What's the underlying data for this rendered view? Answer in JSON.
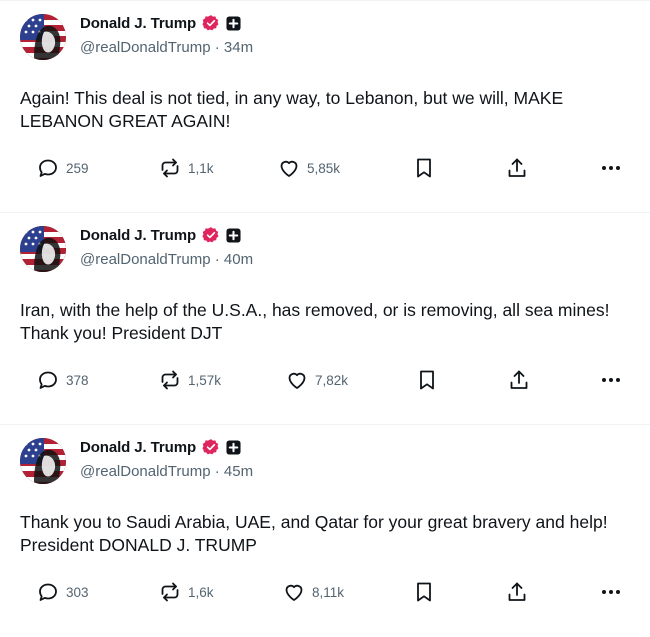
{
  "posts": [
    {
      "author": "Donald J. Trump",
      "handle": "@realDonaldTrump",
      "separator": "·",
      "time": "34m",
      "text": "Again! This deal is not tied, in any way, to Lebanon, but we will, MAKE LEBANON GREAT AGAIN!",
      "replies": "259",
      "reposts": "1,1k",
      "likes": "5,85k"
    },
    {
      "author": "Donald J. Trump",
      "handle": "@realDonaldTrump",
      "separator": "·",
      "time": "40m",
      "text": "Iran, with the help of the U.S.A., has removed, or is removing, all sea mines! Thank you! President DJT",
      "replies": "378",
      "reposts": "1,57k",
      "likes": "7,82k"
    },
    {
      "author": "Donald J. Trump",
      "handle": "@realDonaldTrump",
      "separator": "·",
      "time": "45m",
      "text": "Thank you to Saudi Arabia, UAE, and Qatar for your great bravery and help! President DONALD J. TRUMP",
      "replies": "303",
      "reposts": "1,6k",
      "likes": "8,11k"
    }
  ],
  "icons": {
    "verified": "verified-badge-icon",
    "affiliation": "plus-square-icon",
    "reply": "reply-bubble-icon",
    "repost": "repost-arrows-icon",
    "like": "heart-icon",
    "bookmark": "bookmark-icon",
    "share": "share-upload-icon",
    "more": "more-dots-icon"
  },
  "colors": {
    "verified_badge": "#e0245e",
    "text_primary": "#0f1419",
    "text_secondary": "#536471"
  }
}
